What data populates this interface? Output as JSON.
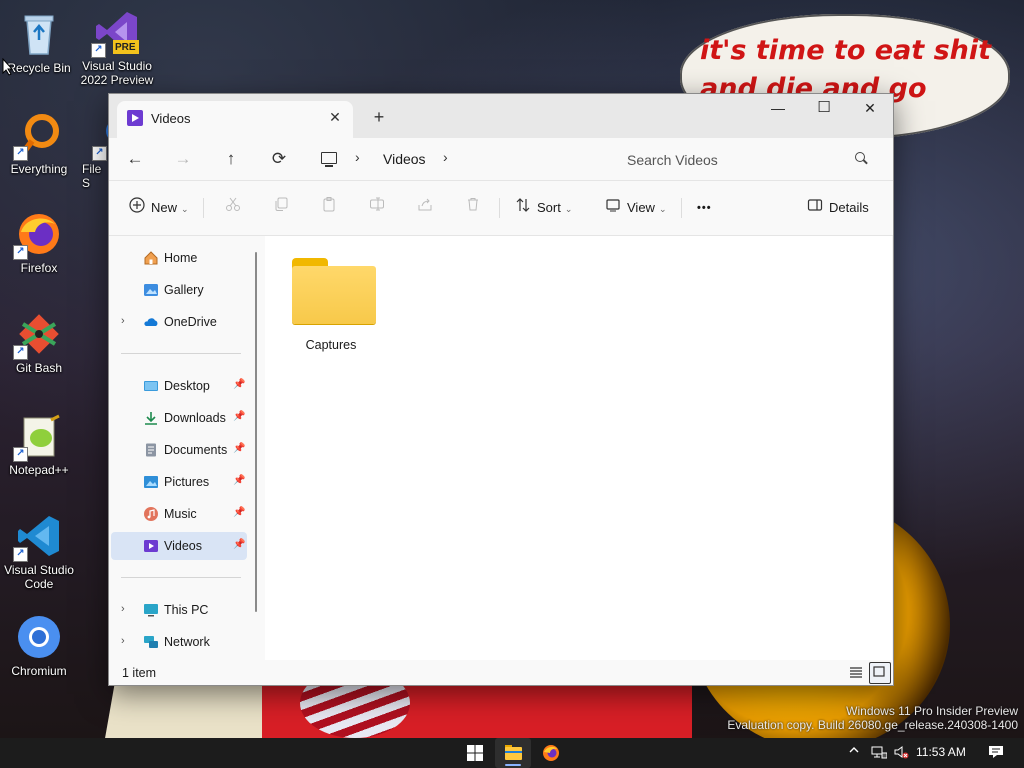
{
  "wallpaper": {
    "bubble_text": "it's time to eat shit and die and go trick vote!"
  },
  "desktop": {
    "icons": [
      {
        "label": "Recycle Bin",
        "icon": "recycle-bin-icon"
      },
      {
        "label": "Visual Studio 2022 Preview",
        "icon": "visual-studio-preview-icon",
        "badge": "PRE"
      },
      {
        "label": "Everything",
        "icon": "everything-search-icon"
      },
      {
        "label": "File S",
        "icon": "file-shortcut-icon"
      },
      {
        "label": "Firefox",
        "icon": "firefox-icon"
      },
      {
        "label": "Git Bash",
        "icon": "git-bash-icon"
      },
      {
        "label": "Notepad++",
        "icon": "notepad-plus-plus-icon"
      },
      {
        "label": "Visual Studio Code",
        "icon": "vscode-icon"
      },
      {
        "label": "Chromium",
        "icon": "chromium-icon"
      }
    ]
  },
  "explorer": {
    "tab": {
      "title": "Videos",
      "close": "✕",
      "add": "+"
    },
    "window_controls": {
      "minimize": "—",
      "maximize": "☐",
      "close": "✕"
    },
    "nav": {
      "back": "←",
      "forward": "→",
      "up": "↑",
      "refresh": "⟳"
    },
    "address": {
      "segments": [
        "Videos"
      ],
      "separator": "›"
    },
    "search": {
      "placeholder": "Search Videos"
    },
    "command_bar": {
      "new_label": "New",
      "sort_label": "Sort",
      "view_label": "View",
      "more_label": "•••",
      "details_label": "Details"
    },
    "nav_pane": {
      "top": [
        {
          "label": "Home",
          "icon": "home-icon",
          "expandable": false
        },
        {
          "label": "Gallery",
          "icon": "gallery-icon",
          "expandable": false
        },
        {
          "label": "OneDrive",
          "icon": "onedrive-icon",
          "expandable": true
        }
      ],
      "quick_access": [
        {
          "label": "Desktop",
          "icon": "desktop-folder-icon",
          "pinned": true
        },
        {
          "label": "Downloads",
          "icon": "downloads-icon",
          "pinned": true
        },
        {
          "label": "Documents",
          "icon": "documents-icon",
          "pinned": true
        },
        {
          "label": "Pictures",
          "icon": "pictures-icon",
          "pinned": true
        },
        {
          "label": "Music",
          "icon": "music-icon",
          "pinned": true
        },
        {
          "label": "Videos",
          "icon": "videos-icon",
          "pinned": true,
          "selected": true
        }
      ],
      "bottom": [
        {
          "label": "This PC",
          "icon": "this-pc-icon",
          "expandable": true
        },
        {
          "label": "Network",
          "icon": "network-icon",
          "expandable": true
        }
      ]
    },
    "items": [
      {
        "name": "Captures",
        "type": "folder"
      }
    ],
    "status": {
      "count": "1 item"
    }
  },
  "watermark": {
    "line1": "Windows 11 Pro Insider Preview",
    "line2": "Evaluation copy. Build 26080.ge_release.240308-1400"
  },
  "taskbar": {
    "apps": [
      {
        "name": "start-button",
        "icon": "windows-icon"
      },
      {
        "name": "file-explorer",
        "icon": "file-explorer-icon",
        "active": true
      },
      {
        "name": "firefox",
        "icon": "firefox-icon"
      }
    ],
    "time": "11:53 AM"
  },
  "colors": {
    "accent": "#0067c0",
    "selection": "#d9e4f5",
    "folder": "#f7c94a",
    "taskbar": "#1c1c1c"
  }
}
